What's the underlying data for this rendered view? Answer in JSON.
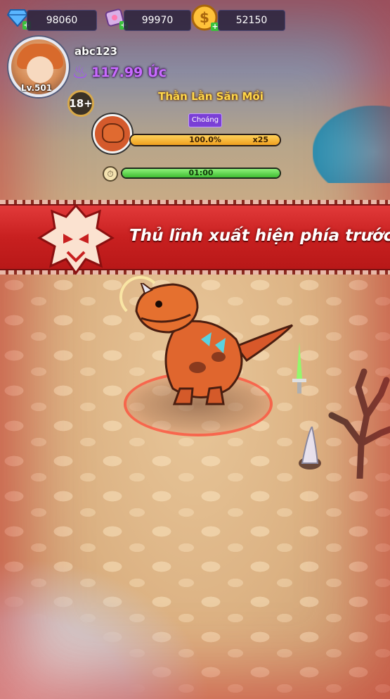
{
  "currency": {
    "diamonds": "98060",
    "gems": "99970",
    "gold": "52150",
    "diamond_icon": "diamond-icon",
    "gem_icon": "gem-icon",
    "gold_icon": "gold-coin-icon"
  },
  "player": {
    "name": "abc123",
    "level": "Lv.501",
    "power": "117.99 Ức",
    "age_badge": "18+"
  },
  "boss": {
    "name": "Thằn Lằn Săn Mồi",
    "status": "Choáng",
    "hp_text": "100.0%",
    "hp_fraction": 1.0,
    "hp_multiplier": "x25",
    "timer_text": "01:00",
    "timer_fraction": 1.0
  },
  "banner": {
    "text": "Thủ lĩnh xuất hiện phía trước!!"
  },
  "colors": {
    "banner_red": "#c82020",
    "power_purple": "#c86bff",
    "boss_name_yellow": "#ffd84a",
    "hp_orange": "#f0a020",
    "timer_green": "#3fbd32"
  }
}
